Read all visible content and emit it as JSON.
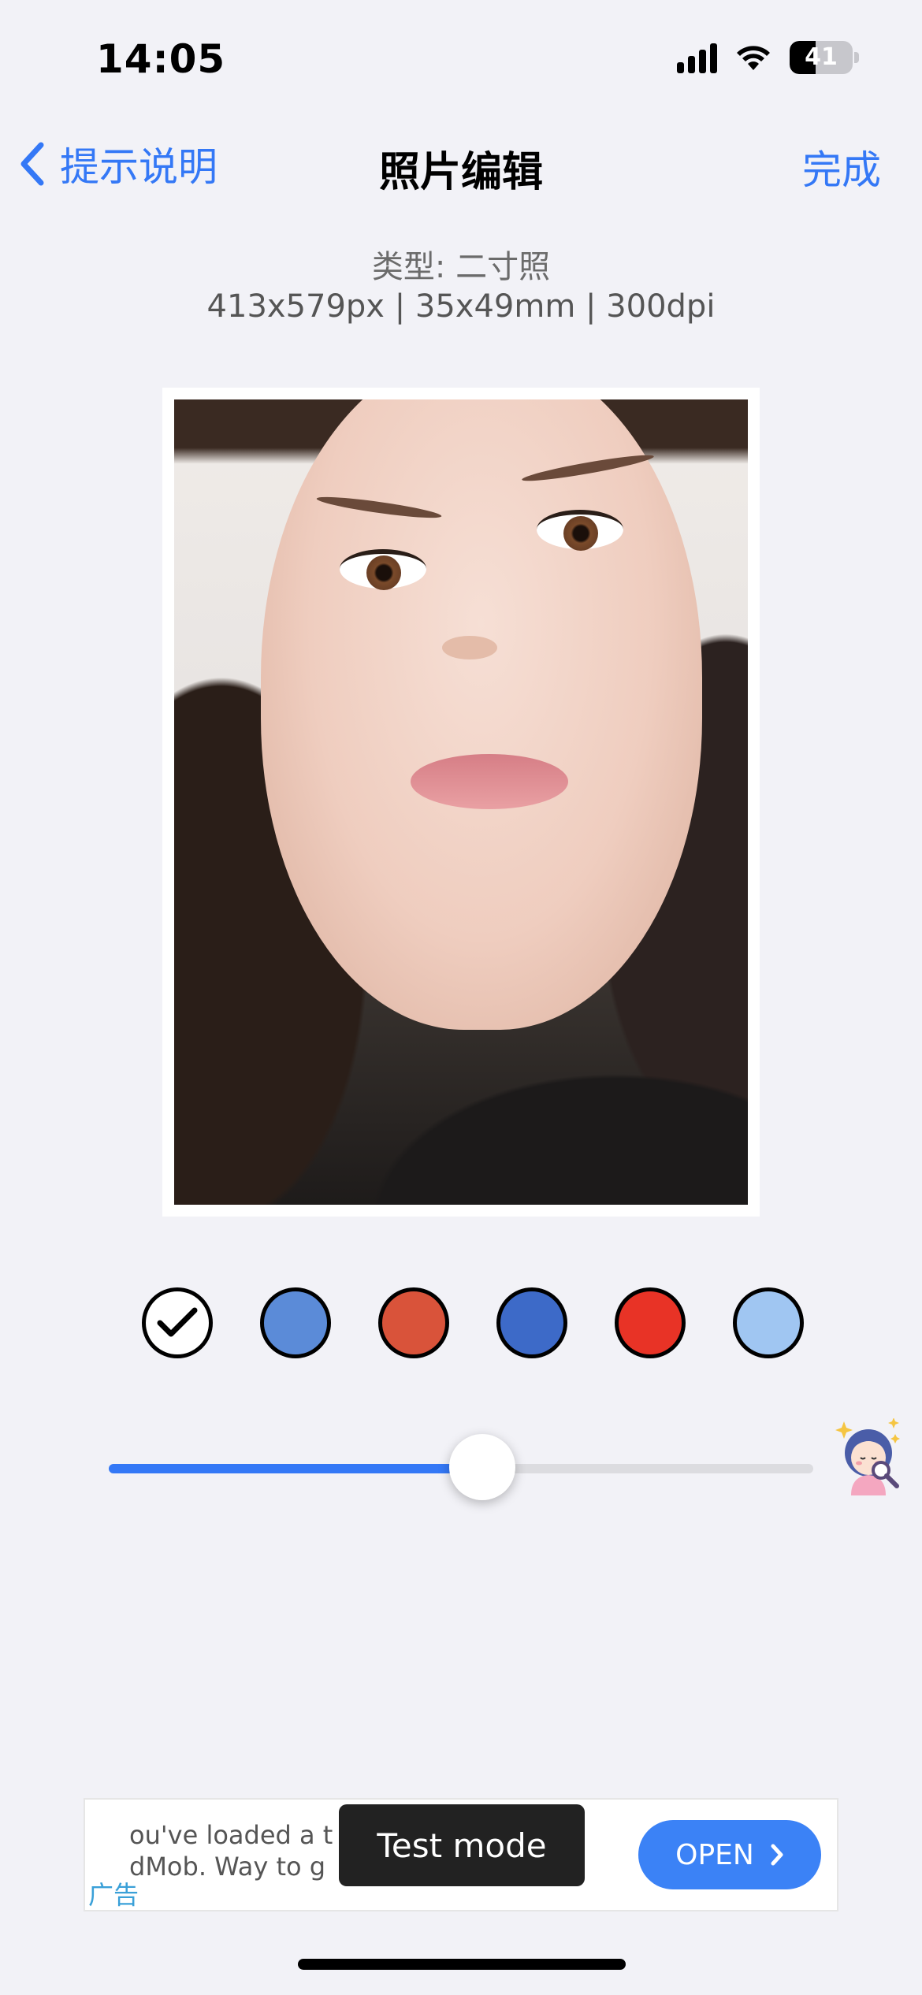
{
  "status_bar": {
    "time": "14:05",
    "battery_level": "41",
    "battery_fraction": 0.41,
    "signal_bars": 4,
    "icons": [
      "cellular-signal-icon",
      "wifi-icon",
      "battery-icon"
    ]
  },
  "nav": {
    "back_label": "提示说明",
    "title": "照片编辑",
    "done_label": "完成"
  },
  "info": {
    "type": "类型: 二寸照",
    "spec": "413x579px | 35x49mm | 300dpi"
  },
  "background_colors": {
    "selected_index": 0,
    "swatches": [
      {
        "name": "white",
        "color": "#ffffff"
      },
      {
        "name": "blue",
        "color": "#5b8bd8"
      },
      {
        "name": "red-orange",
        "color": "#d9533a"
      },
      {
        "name": "dark-blue",
        "color": "#3d6ac8"
      },
      {
        "name": "red",
        "color": "#e83326"
      },
      {
        "name": "light-blue",
        "color": "#a0c6f2"
      }
    ]
  },
  "slider": {
    "value_fraction": 0.53,
    "accent": "#3478f6"
  },
  "ad": {
    "line1": "ou've loaded a t",
    "line2": "dMob. Way to g",
    "label": "广告",
    "open_label": "OPEN",
    "test_mode_label": "Test mode"
  },
  "colors": {
    "accent": "#3478f6",
    "background": "#f2f2f7"
  }
}
